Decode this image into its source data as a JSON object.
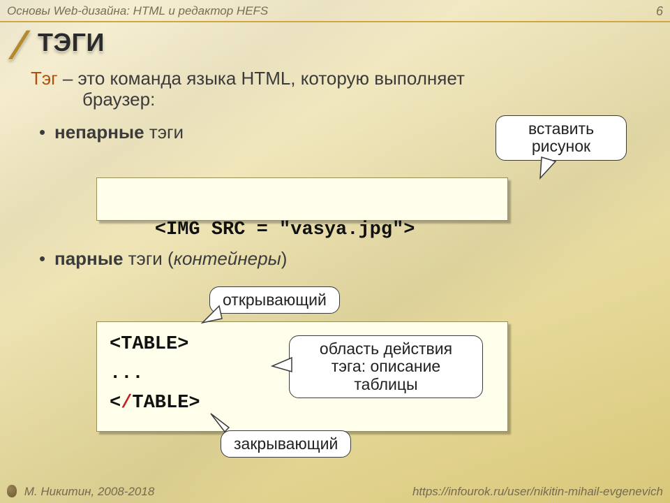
{
  "header": {
    "breadcrumb": "Основы Web-дизайна: HTML и редактор HEFS",
    "page_number": "6"
  },
  "title": "ТЭГИ",
  "lead": {
    "term": "Тэг",
    "rest1": " – это команда языка HTML, которую выполняет",
    "rest2": "браузер:"
  },
  "bullets": {
    "unpaired_bold": "непарные",
    "unpaired_rest": " тэги",
    "paired_bold": "парные",
    "paired_rest": " тэги (",
    "paired_italic": "контейнеры",
    "paired_close": ")"
  },
  "code1": "<IMG SRC = \"vasya.jpg\">",
  "code2": {
    "line1": "<TABLE>",
    "line2": "...",
    "close_open": "<",
    "slash": "/",
    "close_rest": "TABLE>"
  },
  "callouts": {
    "insert1": "вставить",
    "insert2": "рисунок",
    "opening": "открывающий",
    "scope1": "область действия",
    "scope2": "тэга: описание",
    "scope3": "таблицы",
    "closing": "закрывающий"
  },
  "footer": {
    "author": "М. Никитин, 2008-2018",
    "url": "https://infourok.ru/user/nikitin-mihail-evgenevich"
  }
}
